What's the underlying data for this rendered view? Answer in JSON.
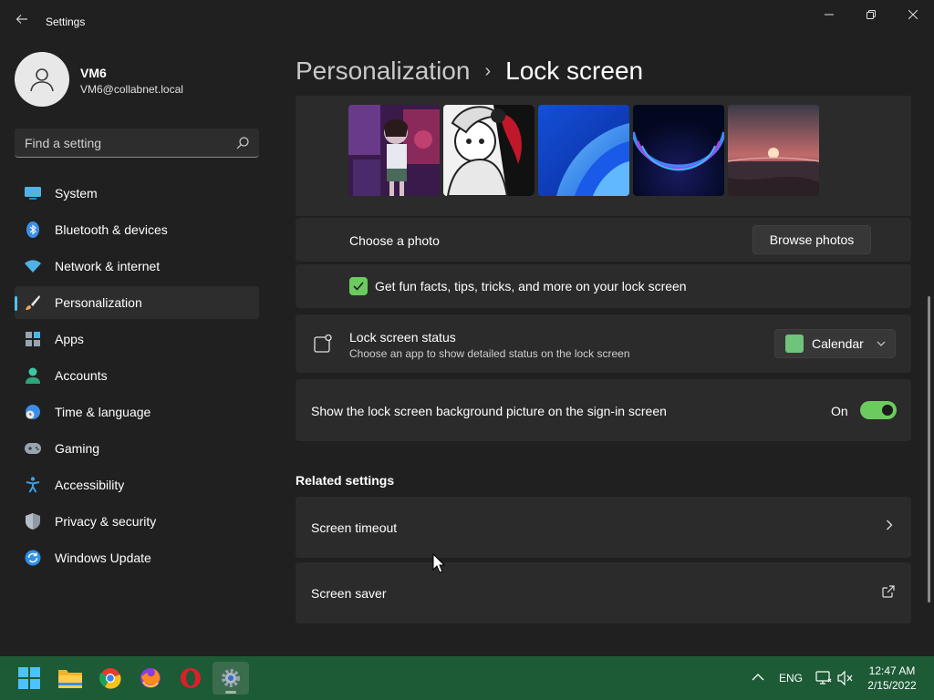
{
  "window": {
    "app_title": "Settings",
    "controls": [
      "minimize",
      "maximize",
      "close"
    ]
  },
  "profile": {
    "name": "VM6",
    "email": "VM6@collabnet.local"
  },
  "search": {
    "placeholder": "Find a setting"
  },
  "sidebar": {
    "items": [
      {
        "label": "System",
        "icon": "system-icon",
        "active": false
      },
      {
        "label": "Bluetooth & devices",
        "icon": "bluetooth-icon",
        "active": false
      },
      {
        "label": "Network & internet",
        "icon": "wifi-icon",
        "active": false
      },
      {
        "label": "Personalization",
        "icon": "brush-icon",
        "active": true
      },
      {
        "label": "Apps",
        "icon": "apps-icon",
        "active": false
      },
      {
        "label": "Accounts",
        "icon": "person-icon",
        "active": false
      },
      {
        "label": "Time & language",
        "icon": "clock-globe-icon",
        "active": false
      },
      {
        "label": "Gaming",
        "icon": "gamepad-icon",
        "active": false
      },
      {
        "label": "Accessibility",
        "icon": "accessibility-icon",
        "active": false
      },
      {
        "label": "Privacy & security",
        "icon": "shield-icon",
        "active": false
      },
      {
        "label": "Windows Update",
        "icon": "update-icon",
        "active": false
      }
    ]
  },
  "breadcrumb": {
    "parent": "Personalization",
    "separator": "›",
    "current": "Lock screen"
  },
  "lock_screen": {
    "photos": [
      {
        "name": "anime-collage-purple"
      },
      {
        "name": "anime-black-white-red"
      },
      {
        "name": "windows-bloom-blue"
      },
      {
        "name": "windows-dark-glow"
      },
      {
        "name": "sunset-lake"
      }
    ],
    "choose_photo_label": "Choose a photo",
    "browse_button": "Browse photos",
    "fun_facts_label": "Get fun facts, tips, tricks, and more on your lock screen",
    "fun_facts_checked": true,
    "status_title": "Lock screen status",
    "status_desc": "Choose an app to show detailed status on the lock screen",
    "status_app": "Calendar",
    "signin_label": "Show the lock screen background picture on the sign-in screen",
    "signin_state": "On",
    "signin_on": true
  },
  "related": {
    "heading": "Related settings",
    "screen_timeout": "Screen timeout",
    "screen_saver": "Screen saver"
  },
  "taskbar": {
    "apps": [
      "start-icon",
      "file-explorer-icon",
      "chrome-icon",
      "firefox-icon",
      "opera-icon",
      "settings-icon"
    ],
    "active_app": "settings-icon",
    "language": "ENG",
    "time": "12:47 AM",
    "date": "2/15/2022"
  },
  "colors": {
    "accent": "#4cc2ff",
    "toggle_on": "#6ccb5f",
    "taskbar": "#1d5a36",
    "background": "#202020",
    "card": "#2b2b2b"
  }
}
